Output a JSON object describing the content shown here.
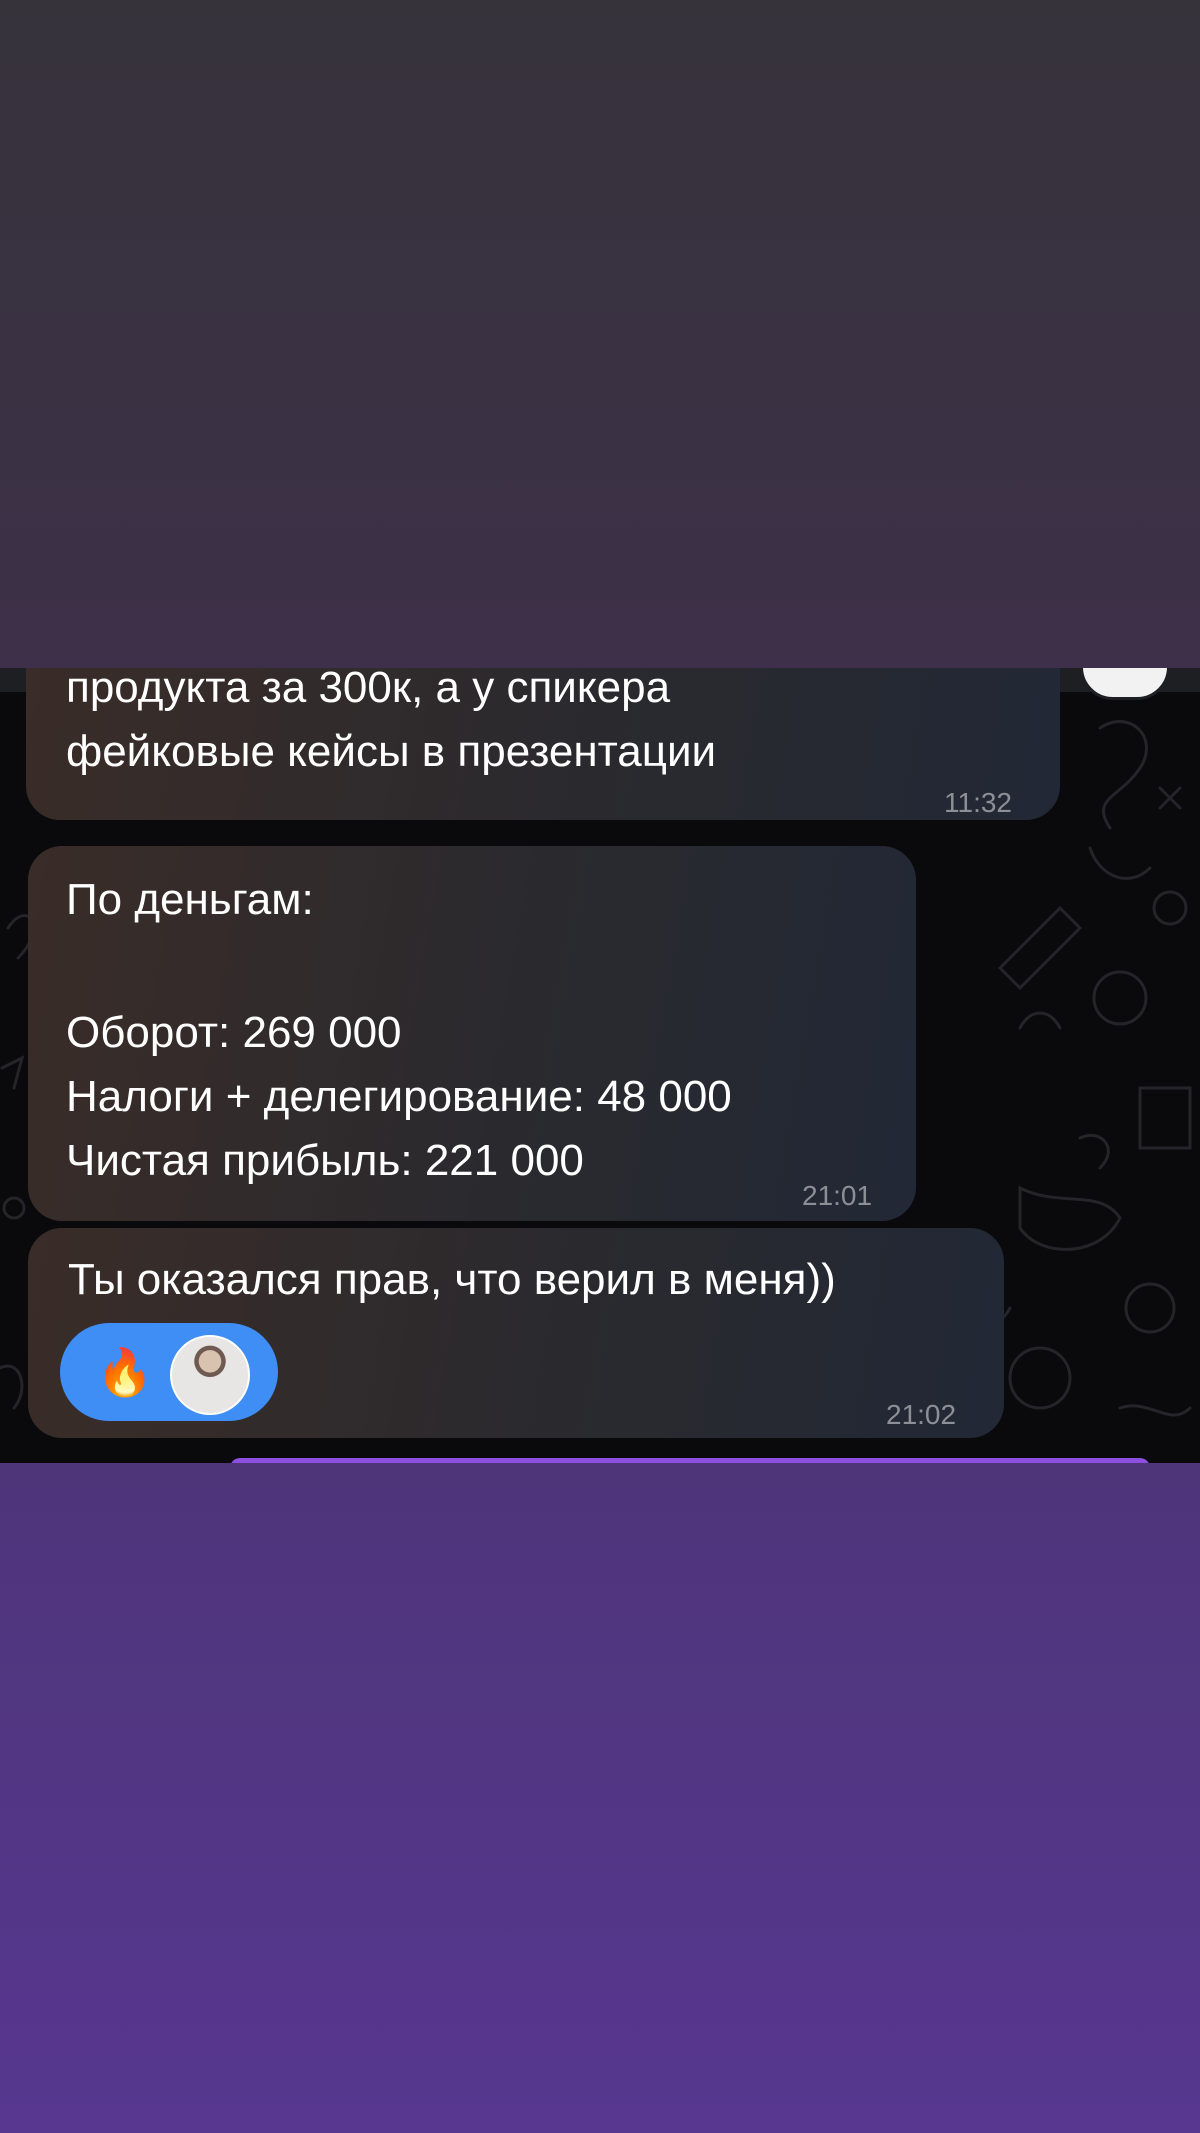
{
  "messages": [
    {
      "lines": [
        "продукта за 300к, а у спикера",
        "фейковые кейсы в презентации"
      ],
      "time": "11:32"
    },
    {
      "lines": [
        "По деньгам:",
        "",
        "Оборот: 269 000",
        "Налоги + делегирование: 48 000",
        "Чистая прибыль: 221 000"
      ],
      "time": "21:01"
    },
    {
      "lines": [
        "Ты оказался прав, что верил в меня))"
      ],
      "time": "21:02",
      "reaction": {
        "emoji": "🔥",
        "icon": "fire-icon",
        "color": "#3e8ef5"
      }
    }
  ]
}
